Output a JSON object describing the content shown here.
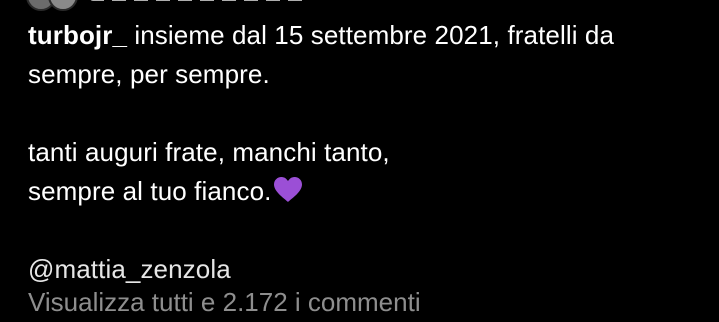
{
  "post": {
    "username": "turbojr_",
    "caption_line1_rest": " insieme dal 15 settembre 2021, fratelli da",
    "caption_line2": "sempre, per sempre.",
    "caption_line3": "tanti auguri frate, manchi tanto,",
    "caption_line4": "sempre al tuo fianco.",
    "heart_icon": "purple-heart-icon",
    "mention": "@mattia_zenzola",
    "view_comments_label": "Visualizza tutti e 2.172 i commenti"
  },
  "colors": {
    "background": "#000000",
    "text": "#ffffff",
    "muted": "#8e8e8e",
    "heart": "#9b4fd6"
  }
}
